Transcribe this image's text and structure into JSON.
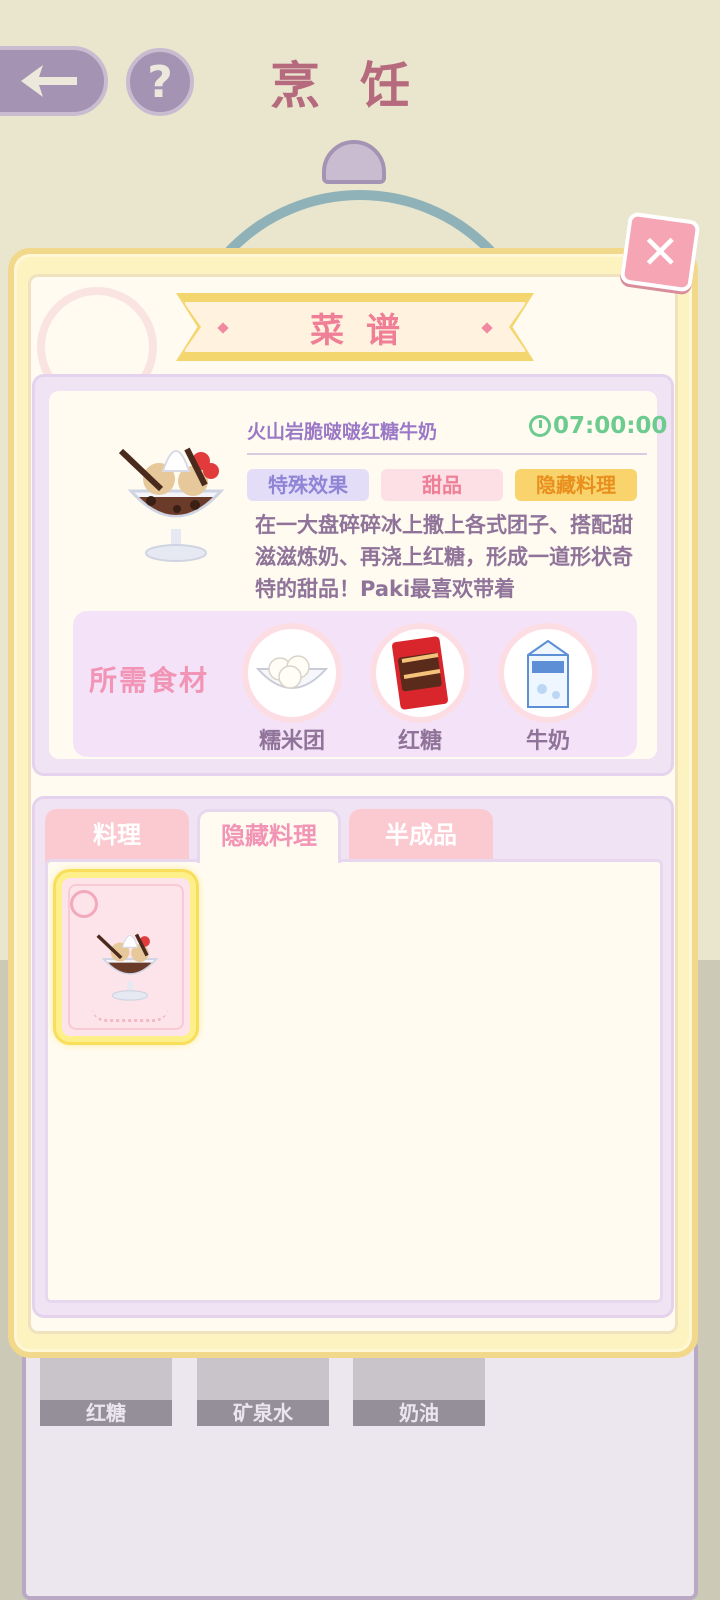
{
  "background": {
    "title": "烹饪",
    "help_label": "?",
    "bottom_slots": [
      "红糖",
      "矿泉水",
      "奶油"
    ]
  },
  "dialog": {
    "title": "菜谱",
    "close_label": "✕"
  },
  "recipe": {
    "name": "火山岩脆啵啵红糖牛奶",
    "timer": "07:00:00",
    "tags": [
      "特殊效果",
      "甜品",
      "隐藏料理"
    ],
    "description": "在一大盘碎碎冰上撒上各式团子、搭配甜滋滋炼奶、再浇上红糖，形成一道形状奇特的甜品！Paki最喜欢带着",
    "ingredients_label": "所需食材",
    "ingredients": [
      {
        "name": "糯米团",
        "icon": "rice-ball-bowl-icon"
      },
      {
        "name": "红糖",
        "icon": "brown-sugar-bag-icon"
      },
      {
        "name": "牛奶",
        "icon": "milk-carton-icon"
      }
    ]
  },
  "tabs": [
    {
      "label": "料理",
      "selected": false
    },
    {
      "label": "隐藏料理",
      "selected": true
    },
    {
      "label": "半成品",
      "selected": false
    }
  ],
  "colors": {
    "accent_pink": "#ef7e97",
    "timer_green": "#6ccb8f",
    "highlight_gold": "#f8de5a"
  }
}
